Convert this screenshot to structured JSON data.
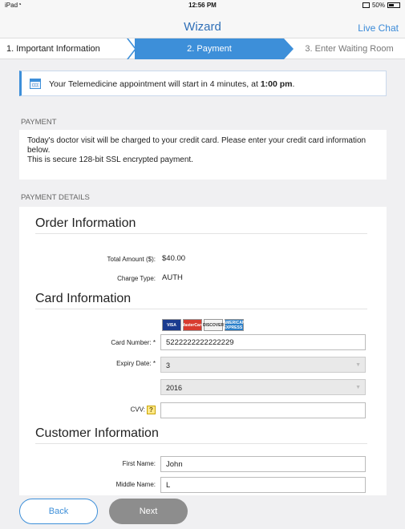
{
  "status": {
    "carrier": "iPad",
    "time": "12:56 PM",
    "battery": "50%",
    "battery_level": 0.5
  },
  "nav": {
    "title": "Wizard",
    "live_chat": "Live Chat"
  },
  "steps": [
    {
      "label": "1. Important Information",
      "state": "done"
    },
    {
      "label": "2. Payment",
      "state": "active"
    },
    {
      "label": "3. Enter Waiting Room",
      "state": "pending"
    }
  ],
  "notice": {
    "text_before": "Your Telemedicine appointment will start in 4 minutes, at ",
    "time": "1:00 pm",
    "text_after": "."
  },
  "payment": {
    "label": "PAYMENT",
    "line1": "Today's doctor visit will be charged to your credit card. Please enter your credit card information below.",
    "line2": "This is secure 128-bit SSL encrypted payment."
  },
  "details": {
    "label": "PAYMENT DETAILS",
    "order": {
      "heading": "Order Information",
      "total_label": "Total Amount ($):",
      "total_value": "$40.00",
      "charge_label": "Charge Type:",
      "charge_value": "AUTH"
    },
    "card": {
      "heading": "Card Information",
      "logos": [
        "VISA",
        "MasterCard",
        "DISCOVER",
        "AMERICAN EXPRESS"
      ],
      "number_label": "Card Number:",
      "number_value": "5222222222222229",
      "expiry_label": "Expiry Date:",
      "expiry_month": "3",
      "expiry_year": "2016",
      "cvv_label": "CVV:",
      "cvv_help": "?",
      "cvv_value": "",
      "required_mark": "*"
    },
    "customer": {
      "heading": "Customer Information",
      "first_label": "First Name:",
      "first_value": "John",
      "middle_label": "Middle Name:",
      "middle_value": "L"
    }
  },
  "buttons": {
    "back": "Back",
    "next": "Next"
  },
  "colors": {
    "accent": "#3d8fd9",
    "title": "#2f6fb7",
    "disabled": "#8d8d8d"
  }
}
